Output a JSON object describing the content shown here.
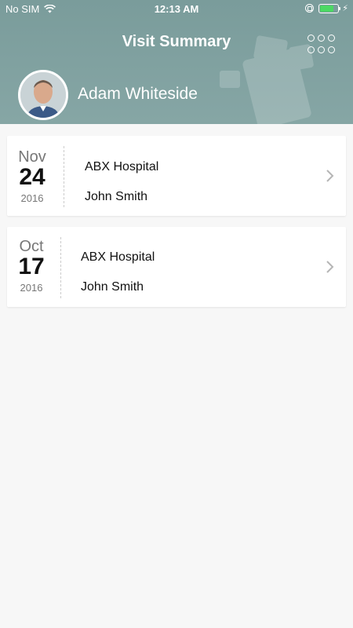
{
  "status_bar": {
    "carrier": "No SIM",
    "time": "12:13 AM",
    "battery_level": 0.75,
    "battery_color": "#4cd964"
  },
  "header": {
    "title": "Visit Summary",
    "menu_icon": "grid-dots-icon",
    "background_color": "#7a9c9b"
  },
  "profile": {
    "name": "Adam Whiteside"
  },
  "visits": [
    {
      "month": "Nov",
      "day": "24",
      "year": "2016",
      "hospital": "ABX Hospital",
      "doctor": "John Smith"
    },
    {
      "month": "Oct",
      "day": "17",
      "year": "2016",
      "hospital": "ABX Hospital",
      "doctor": "John Smith"
    }
  ]
}
